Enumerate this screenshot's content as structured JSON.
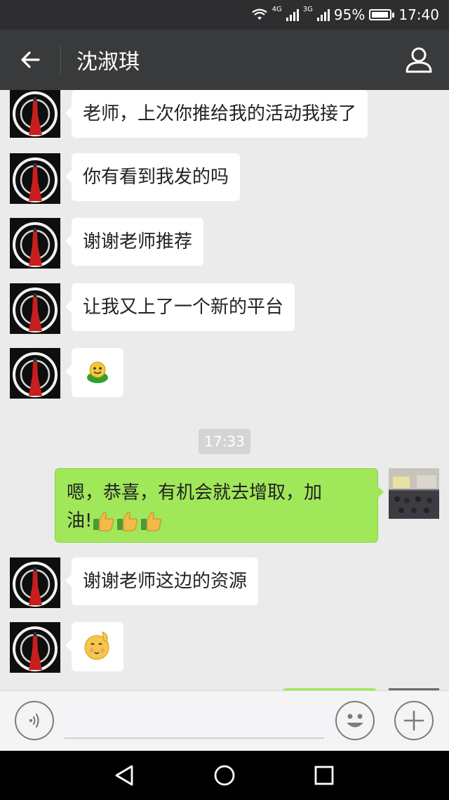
{
  "status_bar": {
    "network_1": "4G",
    "network_2": "3G",
    "battery_percent": "95%",
    "battery_level": 0.95,
    "time": "17:40"
  },
  "header": {
    "title": "沈淑琪",
    "back_icon": "arrow-left-icon",
    "profile_icon": "person-icon"
  },
  "messages": [
    {
      "side": "left",
      "text": "老师，上次你推给我的活动我接了"
    },
    {
      "side": "left",
      "text": "你有看到我发的吗"
    },
    {
      "side": "left",
      "text": "谢谢老师推荐"
    },
    {
      "side": "left",
      "text": "让我又上了一个新的平台"
    },
    {
      "side": "left",
      "sticker": "green-smiley-sticker"
    },
    {
      "timestamp": "17:33"
    },
    {
      "side": "right",
      "text_line1": "嗯，恭喜，有机会就去增取，加",
      "text_line2": "油!",
      "emoji": [
        "thumbs-up",
        "thumbs-up",
        "thumbs-up"
      ]
    },
    {
      "side": "left",
      "text": "谢谢老师这边的资源"
    },
    {
      "side": "left",
      "sticker": "salute-face-emoji"
    }
  ],
  "input_bar": {
    "voice_icon": "voice-icon",
    "emoji_icon": "smiley-icon",
    "plus_icon": "plus-icon"
  },
  "nav_bar": {
    "back_icon": "triangle-back-icon",
    "home_icon": "circle-home-icon",
    "recents_icon": "square-recents-icon"
  },
  "colors": {
    "title_bar": "#383a3c",
    "status_bar": "#2e2e30",
    "chat_bg": "#ebebeb",
    "bubble_right": "#a0e75a",
    "bubble_left": "#ffffff"
  }
}
